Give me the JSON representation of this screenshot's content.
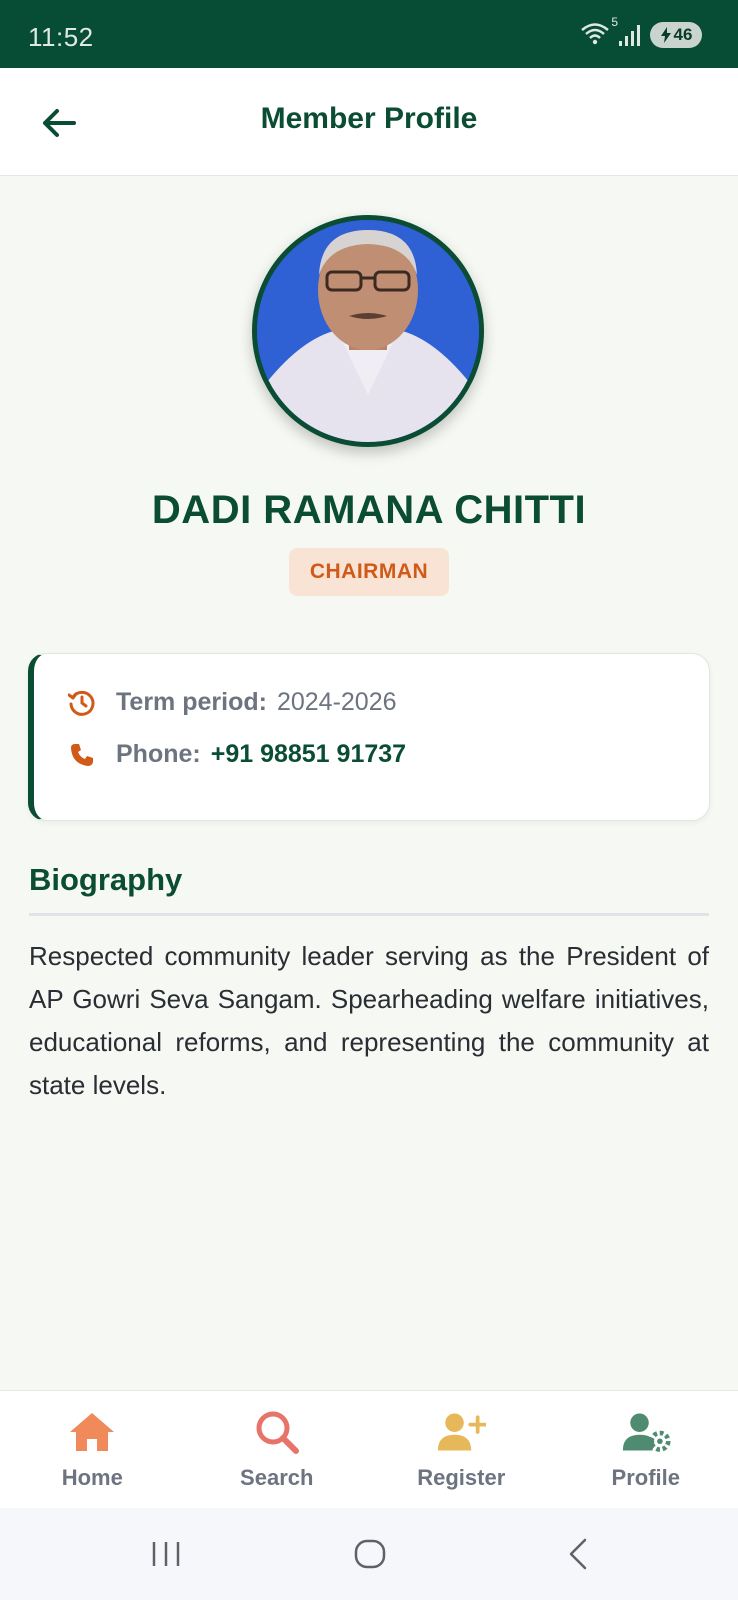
{
  "status_bar": {
    "time": "11:52",
    "wifi_badge": "5",
    "battery": "46"
  },
  "app_bar": {
    "title": "Member Profile",
    "back_icon": "arrow-left-icon"
  },
  "profile": {
    "name": "DADI RAMANA CHITTI",
    "role": "CHAIRMAN"
  },
  "info_card": {
    "term_label": "Term period:",
    "term_value": "2024-2026",
    "term_icon": "history-icon",
    "phone_label": "Phone:",
    "phone_value": "+91 98851 91737",
    "phone_icon": "phone-icon"
  },
  "biography": {
    "heading": "Biography",
    "text": "Respected community leader serving as the President of AP Gowri Seva Sangam. Spearheading welfare initiatives, educational reforms, and representing the community at state levels."
  },
  "bottom_nav": {
    "items": [
      {
        "label": "Home",
        "icon": "home-icon",
        "color": "#f08a5a"
      },
      {
        "label": "Search",
        "icon": "search-icon",
        "color": "#e8736a"
      },
      {
        "label": "Register",
        "icon": "add-user-icon",
        "color": "#e7b85a"
      },
      {
        "label": "Profile",
        "icon": "user-settings-icon",
        "color": "#4f8b70"
      }
    ]
  },
  "colors": {
    "primary": "#0a4d33",
    "accent": "#d05a17",
    "badge_bg": "#f8e3d5"
  }
}
